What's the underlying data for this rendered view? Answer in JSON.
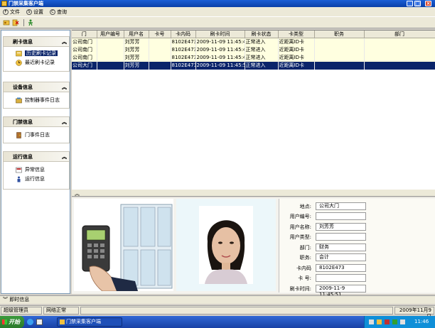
{
  "window": {
    "title": "门禁采集客户端"
  },
  "menu": [
    {
      "key": "F",
      "label": "文件"
    },
    {
      "key": "S",
      "label": "设置"
    },
    {
      "key": "C",
      "label": "查询"
    }
  ],
  "sidebar": {
    "groups": [
      {
        "title": "刷卡信息",
        "items": [
          {
            "label": "历史刷卡记录",
            "selected": true
          },
          {
            "label": "最近刷卡记录",
            "selected": false
          }
        ]
      },
      {
        "title": "设备信息",
        "items": [
          {
            "label": "控制器事件日志"
          }
        ]
      },
      {
        "title": "门禁信息",
        "items": [
          {
            "label": "门事件日志"
          }
        ]
      },
      {
        "title": "运行信息",
        "items": [
          {
            "label": "异常信息"
          },
          {
            "label": "运行信息"
          }
        ]
      }
    ]
  },
  "table": {
    "columns": [
      "门",
      "用户编号",
      "用户名",
      "卡号",
      "卡内码",
      "刷卡时间",
      "刷卡状态",
      "卡类型",
      "职务",
      "部门"
    ],
    "rows": [
      [
        "公司南门",
        "",
        "刘芳芳",
        "",
        "8102E473",
        "2009-11-09 11:45:4",
        "正常进入",
        "近距离ID卡",
        "",
        ""
      ],
      [
        "公司南门",
        "",
        "刘芳芳",
        "",
        "8102E473",
        "2009-11-09 11:45:4",
        "正常进入",
        "近距离ID卡",
        "",
        ""
      ],
      [
        "公司南门",
        "",
        "刘芳芳",
        "",
        "8102E473",
        "2009-11-09 11:45:4",
        "正常进入",
        "近距离ID卡",
        "",
        ""
      ],
      [
        "公司大门",
        "",
        "刘芳芳",
        "",
        "8102E473",
        "2009-11-09 11:45:5",
        "正常进入",
        "近距离ID卡",
        "",
        ""
      ]
    ],
    "selected_row": 3
  },
  "detail": {
    "fields": [
      {
        "label": "地点:",
        "value": "公司大门"
      },
      {
        "label": "用户编号:",
        "value": ""
      },
      {
        "label": "用户名称:",
        "value": "刘芳芳"
      },
      {
        "label": "用户类型:",
        "value": ""
      },
      {
        "label": "部门:",
        "value": "财务"
      },
      {
        "label": "职务:",
        "value": "会计"
      },
      {
        "label": "卡内码",
        "value": "8102E473"
      },
      {
        "label": "卡 号:",
        "value": ""
      },
      {
        "label": "刷卡时间:",
        "value": "2009-11-9 11:45:51"
      }
    ]
  },
  "realtime": {
    "label": "即时信息"
  },
  "status": {
    "user": "超级管理员",
    "network": "网络正常",
    "date": "2009年11月9日"
  },
  "taskbar": {
    "start": "开始",
    "app": "门禁采集客户端",
    "clock": "11:46"
  }
}
